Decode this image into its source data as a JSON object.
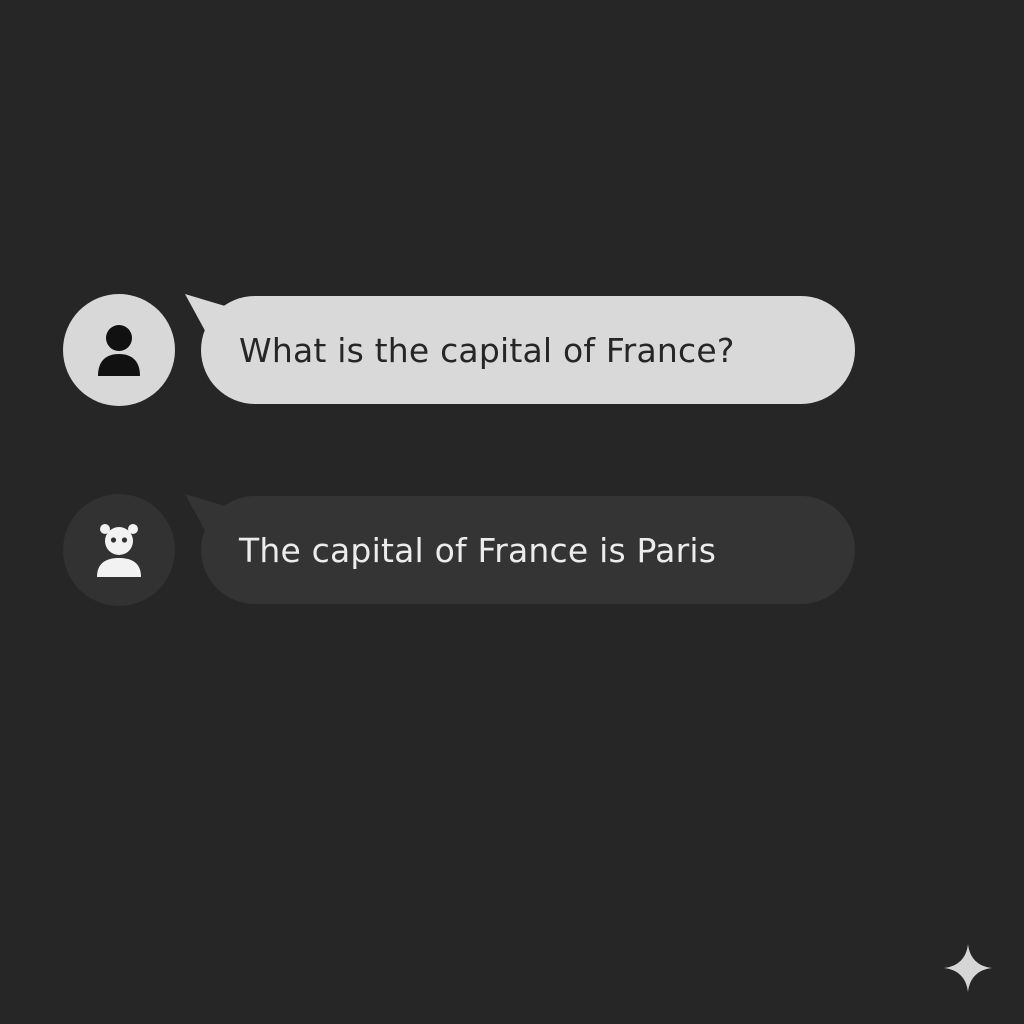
{
  "conversation": {
    "messages": [
      {
        "role": "user",
        "avatar_icon": "person-icon",
        "text": "What is the capital of France?"
      },
      {
        "role": "assistant",
        "avatar_icon": "bot-icon",
        "text": "The capital of France is Paris"
      }
    ]
  },
  "theme": {
    "background": "#262626",
    "user_bubble": "#d9d9d9",
    "user_text": "#262626",
    "assistant_bubble": "#343434",
    "assistant_text": "#ececec"
  },
  "corner_icon": "sparkle-icon"
}
